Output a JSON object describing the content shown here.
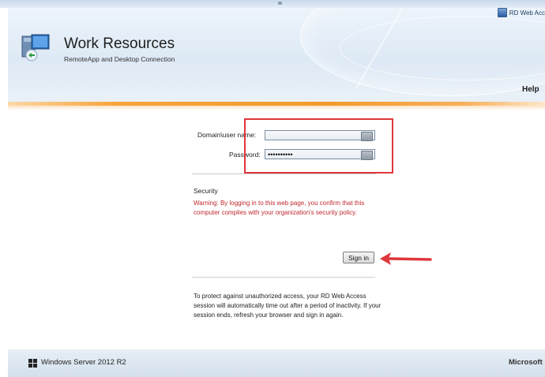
{
  "top_bar": {
    "rd_web_access_label": "RD Web Acc"
  },
  "header": {
    "title": "Work Resources",
    "subtitle": "RemoteApp and Desktop Connection",
    "help_label": "Help"
  },
  "login": {
    "username_label": "Domain\\user name:",
    "username_value": "",
    "password_label": "Password:",
    "password_value": "••••••••••",
    "security_title": "Security",
    "warning_text": "Warning: By logging in to this web page, you confirm that this computer complies with your organization's security policy.",
    "signin_label": "Sign in",
    "timeout_note": "To protect against unauthorized access, your RD Web Access session will automatically time out after a period of inactivity. If your session ends, refresh your browser and sign in again."
  },
  "footer": {
    "os_label": "Windows Server 2012 R2",
    "brand_label": "Microsoft"
  },
  "annotation": {
    "highlight_color": "#e0373d"
  },
  "colors": {
    "accent_orange": "#f39a2b",
    "warning_red": "#c0282d"
  }
}
